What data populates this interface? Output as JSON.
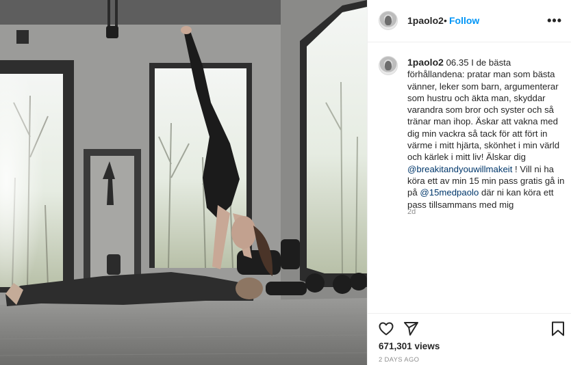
{
  "post": {
    "username": "1paolo2",
    "separator": "•",
    "follow_label": "Follow",
    "more_label": "•••",
    "caption_user": "1paolo2",
    "caption_parts": [
      {
        "type": "text",
        "value": " 06.35 I de bästa förhållandena: pratar man som bästa vänner, leker som barn, argumenterar som hustru och äkta man, skyddar varandra som bror och syster och så tränar man ihop. Äskar att vakna med dig min vackra så tack för att fört in värme i mitt hjärta, skönhet i min värld och kärlek i mitt liv! Älskar dig "
      },
      {
        "type": "mention",
        "value": "@breakitandyouwillmakeit"
      },
      {
        "type": "text",
        "value": " ! Vill ni ha köra ett av min 15 min pass gratis gå in på "
      },
      {
        "type": "mention",
        "value": "@15medpaolo"
      },
      {
        "type": "text",
        "value": " där ni kan köra ett pass tillsammans med mig"
      }
    ],
    "age": "2d",
    "views": "671,301 views",
    "date": "2 DAYS AGO"
  },
  "icons": {
    "like": "heart-icon",
    "share": "paper-plane-icon",
    "save": "bookmark-icon",
    "more": "ellipsis-icon"
  },
  "colors": {
    "link": "#0095f6",
    "mention": "#00376b",
    "muted": "#8e8e8e",
    "text": "#262626"
  }
}
